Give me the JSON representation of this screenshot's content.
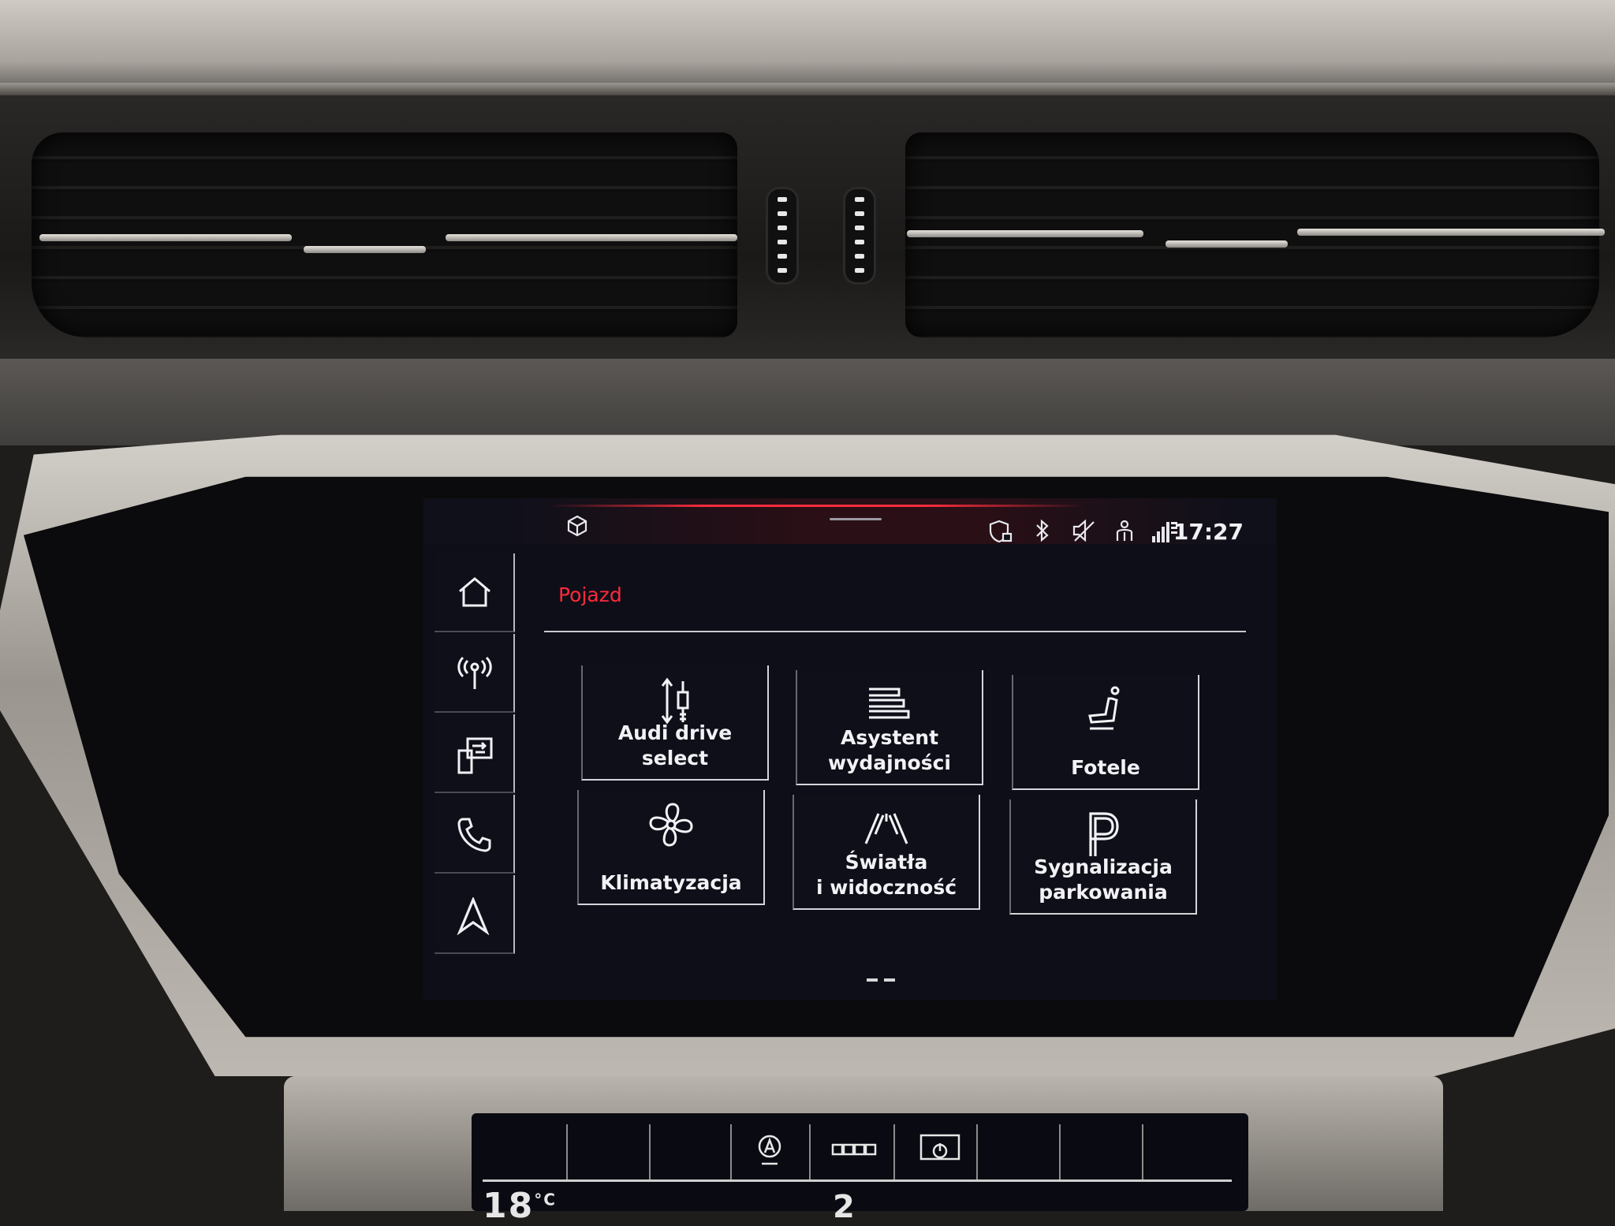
{
  "status_bar": {
    "clock": "17:27",
    "icons": [
      "app-cube-icon",
      "privacy-shield-icon",
      "bluetooth-icon",
      "mute-icon",
      "passenger-icon",
      "lte-signal-icon"
    ]
  },
  "sidebar": {
    "items": [
      {
        "name": "home",
        "icon": "home-icon"
      },
      {
        "name": "media",
        "icon": "radio-antenna-icon"
      },
      {
        "name": "smartphone",
        "icon": "phone-interface-icon"
      },
      {
        "name": "phone",
        "icon": "phone-handset-icon"
      },
      {
        "name": "navigation",
        "icon": "navigation-arrow-icon"
      }
    ]
  },
  "page": {
    "title": "Pojazd"
  },
  "tiles": [
    {
      "label": "Audi drive\nselect",
      "icon": "drive-select-icon"
    },
    {
      "label": "Asystent\nwydajności",
      "icon": "efficiency-stack-icon"
    },
    {
      "label": "Fotele",
      "icon": "seat-icon"
    },
    {
      "label": "Klimatyzacja",
      "icon": "fan-icon"
    },
    {
      "label": "Światła\ni widoczność",
      "icon": "road-lights-icon"
    },
    {
      "label": "Sygnalizacja\nparkowania",
      "icon": "parking-p-icon"
    }
  ],
  "lower_screen": {
    "temperature": "18",
    "temperature_unit": "°C",
    "fan_level": "2",
    "icons": [
      "auto-off-icon",
      "seat-heating-icon",
      "power-icon"
    ]
  },
  "colors": {
    "accent_red": "#ff2a3a",
    "screen_bg": "#0e0e18",
    "text": "#f2f2f6"
  }
}
